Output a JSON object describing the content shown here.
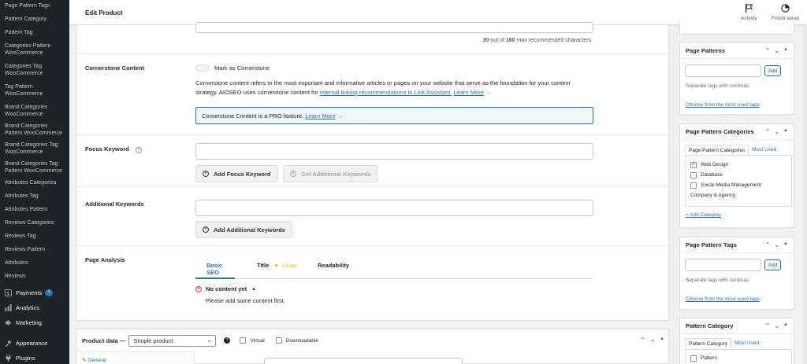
{
  "sidebar": {
    "submenu": [
      "Page Pattern Tags",
      "Pattern Category",
      "Pattern Tag",
      "Categories Pattern WooCommerce",
      "Categories Tag WooCommerce",
      "Tag Pattern WooCommerce",
      "Brand Categories WooCommerce",
      "Brand Categories Pattern WooCommerce",
      "Brand Categories Tag WooCommerce",
      "Brand Categories Tag Pattern WooCommerce",
      "Attributes Categories",
      "Attributes Tag",
      "Attributes Pattern",
      "Reviews Categories",
      "Reviews Tag",
      "Reviews Pattern",
      "Attributes",
      "Reviews"
    ],
    "main": [
      {
        "label": "Payments",
        "icon": "payments-icon",
        "badge": "1"
      },
      {
        "label": "Analytics",
        "icon": "analytics-icon"
      },
      {
        "label": "Marketing",
        "icon": "marketing-icon"
      },
      {
        "label": "Appearance",
        "icon": "appearance-icon"
      },
      {
        "label": "Plugins",
        "icon": "plugins-icon"
      }
    ]
  },
  "topbar": {
    "title": "Edit Product",
    "activity": "Activity",
    "finish_setup": "Finish setup"
  },
  "seo": {
    "char_count": "30",
    "char_max": "160",
    "char_text_mid": " out of ",
    "char_text_end": " max recommended characters.",
    "cornerstone_label": "Cornerstone Content",
    "cornerstone_toggle": "Mark as Cornerstone",
    "cornerstone_desc": "Cornerstone content refers to the most important and informative articles or pages on your website that serve as the foundation for your content strategy. AIOSEO uses cornerstone content for ",
    "cornerstone_link": "internal linking recommendations in Link Assistant.",
    "learn_more": "Learn More",
    "pro_notice": "Cornerstone Content is a PRO feature.",
    "focus_label": "Focus Keyword",
    "add_focus": "Add Focus Keyword",
    "get_additional": "Get Additional Keywords",
    "additional_label": "Additional Keywords",
    "add_additional": "Add Additional Keywords",
    "analysis_label": "Page Analysis",
    "tabs": {
      "basic": "Basic SEO",
      "title": "Title",
      "error": "1 Error",
      "readability": "Readability"
    },
    "no_content": "No content yet",
    "no_content_desc": "Please add some content first."
  },
  "product_data": {
    "label": "Product data —",
    "type": "Simple product",
    "virtual": "Virtual",
    "downloadable": "Downloadable",
    "general": "General"
  },
  "right": {
    "page_patterns": {
      "title": "Page Patterns",
      "add": "Add",
      "hint": "Separate tags with commas",
      "choose": "Choose from the most used tags"
    },
    "page_pattern_categories": {
      "title": "Page Pattern Categories",
      "tab_all": "Page Pattern Categories",
      "tab_used": "Most Used",
      "items": [
        {
          "label": "Web Design",
          "checked": true
        },
        {
          "label": "Database",
          "checked": false
        },
        {
          "label": "Social Media Management",
          "checked": false
        }
      ],
      "extra": "Company & Agency",
      "add": "+ Add Category"
    },
    "page_pattern_tags": {
      "title": "Page Pattern Tags",
      "add": "Add",
      "hint": "Separate tags with commas",
      "choose": "Choose from the most used tags"
    },
    "pattern_category": {
      "title": "Pattern Category",
      "tab_all": "Pattern Category",
      "tab_used": "Most Used",
      "first_item": "Pattern"
    }
  },
  "colors": {
    "accent": "#2271b1",
    "sidebar_bg": "#1d2327",
    "error": "#d63638",
    "warning": "#f0a000"
  }
}
